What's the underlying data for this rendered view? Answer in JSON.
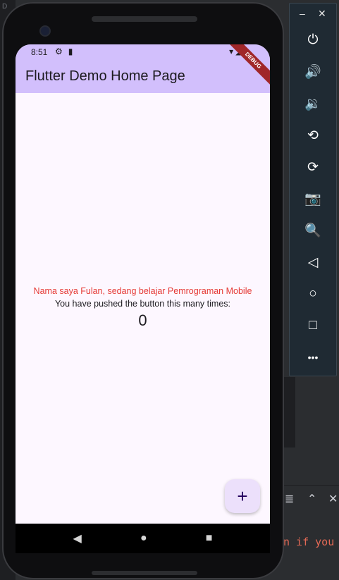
{
  "ide": {
    "top_left_text": "D",
    "terminal_text": "n if you",
    "terminal_icons": [
      "wrap-icon",
      "chevron-up-icon",
      "close-icon"
    ]
  },
  "emulator_toolbar": {
    "window_controls": [
      "minimize",
      "close"
    ],
    "buttons": [
      {
        "name": "power-icon",
        "glyph": "⏻"
      },
      {
        "name": "volume-up-icon",
        "glyph": "🔊"
      },
      {
        "name": "volume-down-icon",
        "glyph": "🔉"
      },
      {
        "name": "rotate-left-icon",
        "glyph": "⟲"
      },
      {
        "name": "rotate-right-icon",
        "glyph": "⟳"
      },
      {
        "name": "camera-icon",
        "glyph": "📷"
      },
      {
        "name": "zoom-icon",
        "glyph": "🔍"
      },
      {
        "name": "back-icon",
        "glyph": "◁"
      },
      {
        "name": "home-icon",
        "glyph": "○"
      },
      {
        "name": "overview-icon",
        "glyph": "□"
      },
      {
        "name": "more-icon",
        "glyph": "•••"
      }
    ]
  },
  "phone": {
    "status_bar": {
      "time": "8:51"
    },
    "app_bar": {
      "title": "Flutter Demo Home Page"
    },
    "debug_banner": "DEBUG",
    "body": {
      "message_red": "Nama saya Fulan, sedang belajar Pemrograman Mobile",
      "message": "You have pushed the button this many times:",
      "counter": "0"
    },
    "fab": {
      "label": "+"
    },
    "nav_bar": [
      "back",
      "home",
      "recents"
    ]
  },
  "colors": {
    "app_bar": "#d2bffc",
    "screen_bg": "#fdf7ff",
    "red_text": "#e53935",
    "fab_bg": "#ece0fb",
    "ide_terminal_text": "#e36955"
  }
}
